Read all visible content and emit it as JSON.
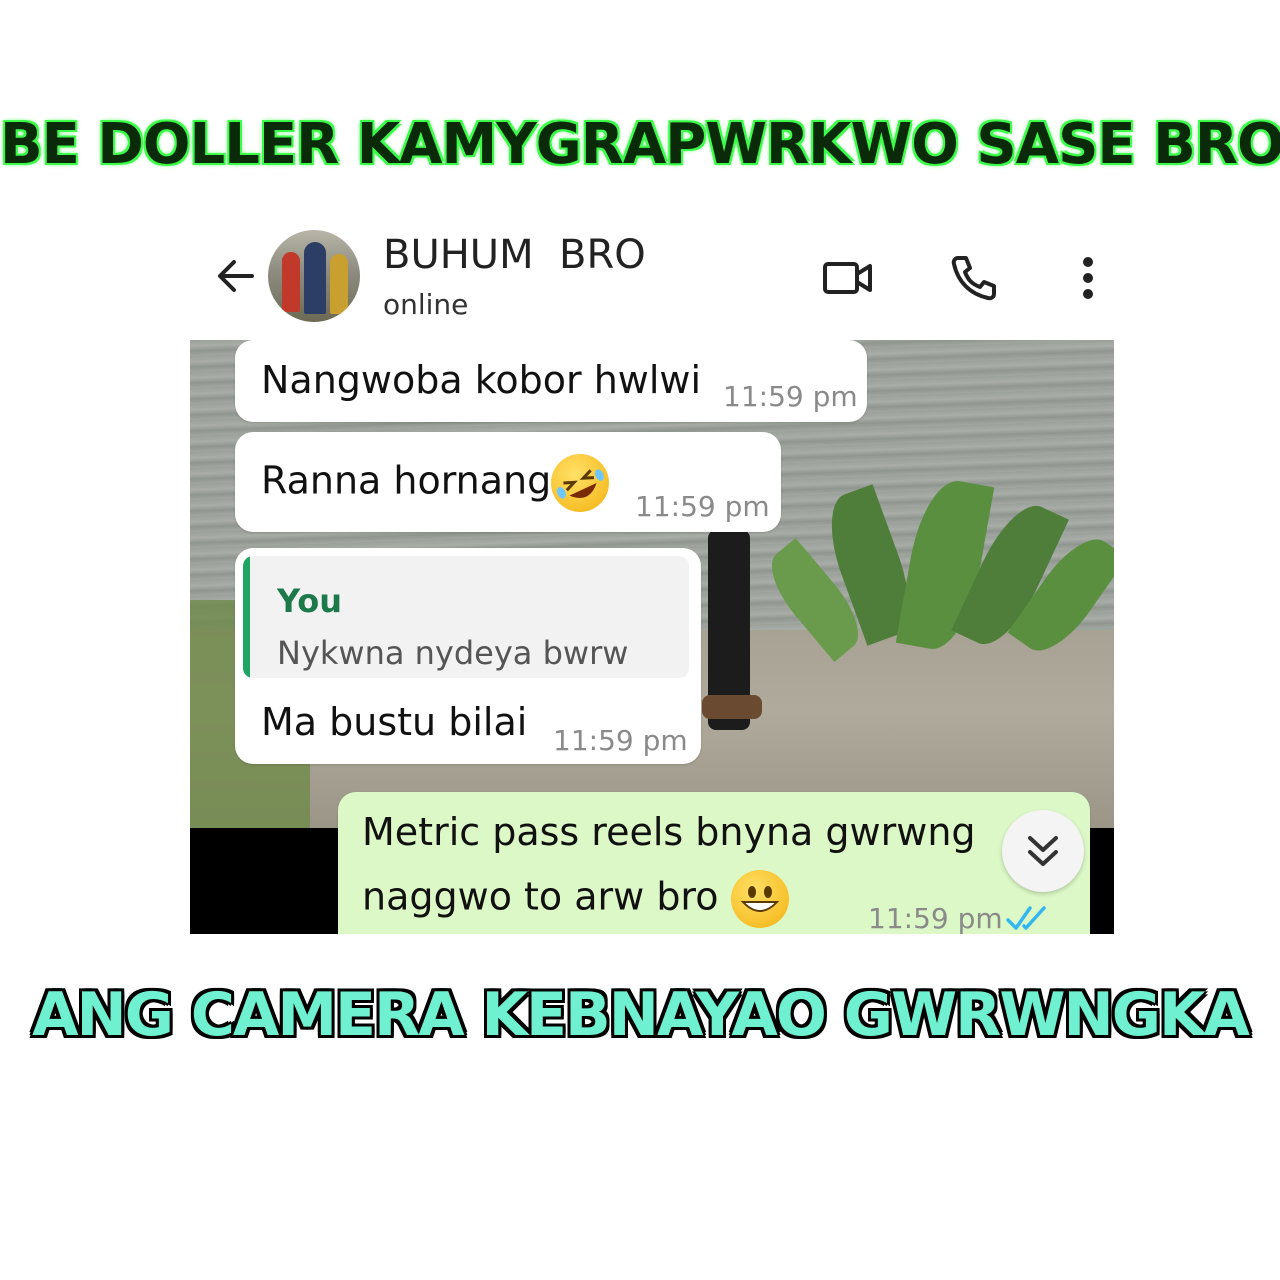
{
  "captions": {
    "top": "BE DOLLER KAMYGRAPWRKWO SASE BRO",
    "bottom": "ANG CAMERA KEBNAYAO GWRWNGKA"
  },
  "header": {
    "contact_name": "BUHUM  BRO",
    "status": "online",
    "icons": [
      "back-arrow-icon",
      "video-call-icon",
      "phone-icon",
      "more-options-icon"
    ]
  },
  "messages": [
    {
      "direction": "incoming",
      "text": "Nangwoba kobor hwlwi",
      "time": "11:59 pm"
    },
    {
      "direction": "incoming",
      "text": "Ranna hornang",
      "emoji": "rolling-on-floor-laughing-emoji",
      "time": "11:59 pm"
    },
    {
      "direction": "incoming",
      "reply_to": {
        "author": "You",
        "text": "Nykwna nydeya bwrw"
      },
      "text": "Ma bustu bilai",
      "time": "11:59 pm"
    },
    {
      "direction": "outgoing",
      "lines": [
        "Metric pass reels bnyna gwrwng",
        "naggwo to arw bro"
      ],
      "emoji": "grinning-face-emoji",
      "time": "11:59 pm",
      "status": "read"
    }
  ],
  "colors": {
    "outgoing_bubble": "#dcf8c6",
    "incoming_bubble": "#ffffff",
    "reply_bar": "#1fa463",
    "read_ticks": "#34b7f1"
  }
}
